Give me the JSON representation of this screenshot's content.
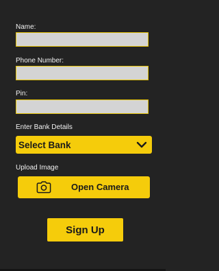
{
  "form": {
    "name_label": "Name:",
    "name_value": "",
    "phone_label": "Phone Number:",
    "phone_value": "",
    "pin_label": "Pin:",
    "pin_value": "",
    "bank_label": "Enter Bank Details",
    "bank_select_value": "Select Bank",
    "upload_label": "Upload Image",
    "camera_button_label": "Open Camera",
    "camera_icon": "camera-icon",
    "chevron_icon": "chevron-down-icon",
    "signup_button_label": "Sign Up"
  },
  "colors": {
    "background": "#232323",
    "accent": "#f5cc0b",
    "field_fill": "#d4d4d4",
    "field_border": "#e8c60a"
  }
}
